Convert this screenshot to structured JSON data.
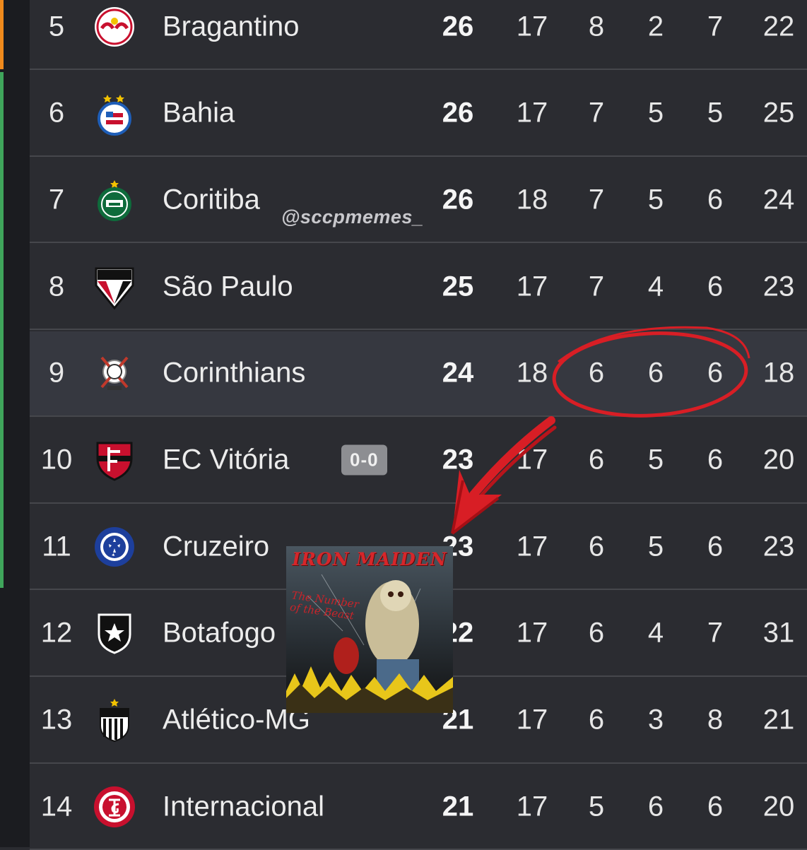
{
  "watermark": "@sccpmemes_",
  "rows": [
    {
      "pos": "5",
      "team": "Bragantino",
      "crest": "bragantino-crest",
      "pts": "26",
      "pj": "17",
      "v": "8",
      "e": "2",
      "d": "7",
      "sg": "22"
    },
    {
      "pos": "6",
      "team": "Bahia",
      "crest": "bahia-crest",
      "pts": "26",
      "pj": "17",
      "v": "7",
      "e": "5",
      "d": "5",
      "sg": "25"
    },
    {
      "pos": "7",
      "team": "Coritiba",
      "crest": "coritiba-crest",
      "pts": "26",
      "pj": "18",
      "v": "7",
      "e": "5",
      "d": "6",
      "sg": "24"
    },
    {
      "pos": "8",
      "team": "São Paulo",
      "crest": "sao-paulo-crest",
      "pts": "25",
      "pj": "17",
      "v": "7",
      "e": "4",
      "d": "6",
      "sg": "23"
    },
    {
      "pos": "9",
      "team": "Corinthians",
      "crest": "corinthians-crest",
      "pts": "24",
      "pj": "18",
      "v": "6",
      "e": "6",
      "d": "6",
      "sg": "18"
    },
    {
      "pos": "10",
      "team": "EC Vitória",
      "crest": "vitoria-crest",
      "pts": "23",
      "pj": "17",
      "v": "6",
      "e": "5",
      "d": "6",
      "sg": "20",
      "live": "0-0"
    },
    {
      "pos": "11",
      "team": "Cruzeiro",
      "crest": "cruzeiro-crest",
      "pts": "23",
      "pj": "17",
      "v": "6",
      "e": "5",
      "d": "6",
      "sg": "23"
    },
    {
      "pos": "12",
      "team": "Botafogo",
      "crest": "botafogo-crest",
      "pts": "22",
      "pj": "17",
      "v": "6",
      "e": "4",
      "d": "7",
      "sg": "31"
    },
    {
      "pos": "13",
      "team": "Atlético-MG",
      "crest": "atletico-mg-crest",
      "pts": "21",
      "pj": "17",
      "v": "6",
      "e": "3",
      "d": "8",
      "sg": "21"
    },
    {
      "pos": "14",
      "team": "Internacional",
      "crest": "internacional-crest",
      "pts": "21",
      "pj": "17",
      "v": "5",
      "e": "6",
      "d": "6",
      "sg": "20"
    }
  ],
  "album": {
    "title": "IRON MAIDEN",
    "subtitle": "The Number of the Beast"
  },
  "colors": {
    "background": "#2b2c31",
    "highlight_row": "#363840",
    "annotation_red": "#d81e25",
    "stripe_orange": "#f08a1c",
    "stripe_green": "#3fa55b"
  }
}
